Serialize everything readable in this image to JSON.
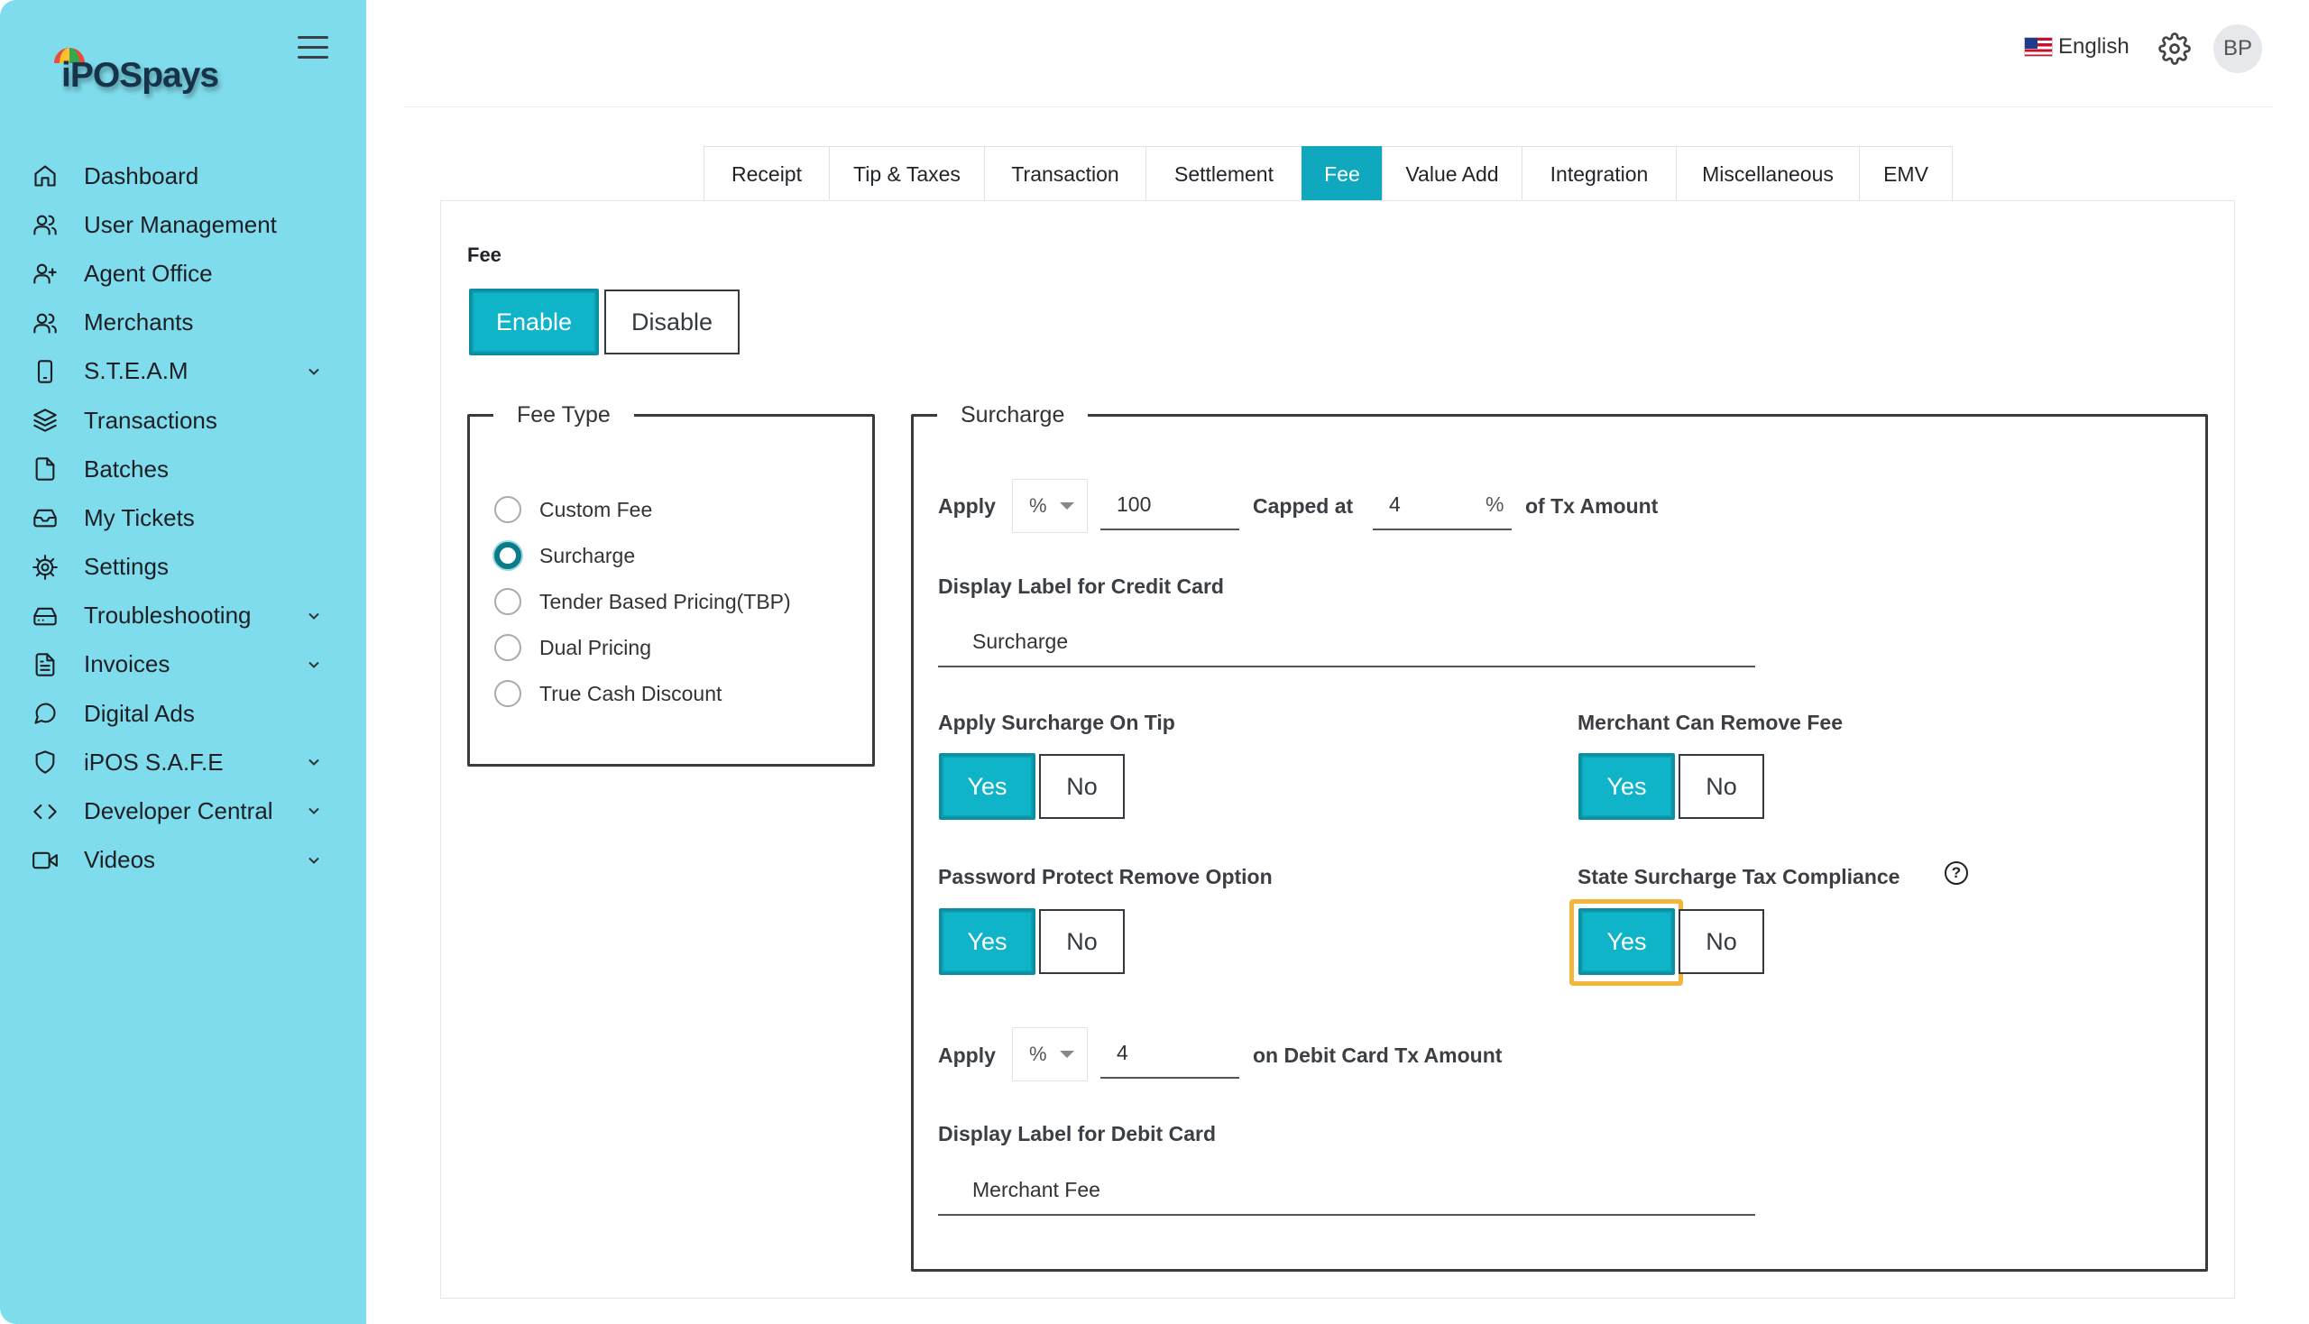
{
  "brand": {
    "logo_text": "iPOSpays"
  },
  "sidebar": {
    "items": [
      {
        "label": "Dashboard",
        "icon": "home-icon",
        "has_chevron": false
      },
      {
        "label": "User Management",
        "icon": "users-icon",
        "has_chevron": false
      },
      {
        "label": "Agent Office",
        "icon": "user-plus-icon",
        "has_chevron": false
      },
      {
        "label": "Merchants",
        "icon": "users-icon",
        "has_chevron": false
      },
      {
        "label": "S.T.E.A.M",
        "icon": "tablet-icon",
        "has_chevron": true
      },
      {
        "label": "Transactions",
        "icon": "layers-icon",
        "has_chevron": false
      },
      {
        "label": "Batches",
        "icon": "file-icon",
        "has_chevron": false
      },
      {
        "label": "My Tickets",
        "icon": "inbox-icon",
        "has_chevron": false
      },
      {
        "label": "Settings",
        "icon": "gear-icon",
        "has_chevron": false
      },
      {
        "label": "Troubleshooting",
        "icon": "hard-drive-icon",
        "has_chevron": true
      },
      {
        "label": "Invoices",
        "icon": "file-text-icon",
        "has_chevron": true
      },
      {
        "label": "Digital Ads",
        "icon": "message-circle-icon",
        "has_chevron": false
      },
      {
        "label": "iPOS S.A.F.E",
        "icon": "shield-icon",
        "has_chevron": true
      },
      {
        "label": "Developer Central",
        "icon": "code-icon",
        "has_chevron": true
      },
      {
        "label": "Videos",
        "icon": "video-icon",
        "has_chevron": true
      }
    ]
  },
  "header": {
    "language": "English",
    "avatar_initials": "BP"
  },
  "tabs": [
    {
      "label": "Receipt",
      "active": false
    },
    {
      "label": "Tip & Taxes",
      "active": false
    },
    {
      "label": "Transaction",
      "active": false
    },
    {
      "label": "Settlement",
      "active": false
    },
    {
      "label": "Fee",
      "active": true
    },
    {
      "label": "Value Add",
      "active": false
    },
    {
      "label": "Integration",
      "active": false
    },
    {
      "label": "Miscellaneous",
      "active": false
    },
    {
      "label": "EMV",
      "active": false
    }
  ],
  "fee": {
    "section_label": "Fee",
    "enable_label": "Enable",
    "disable_label": "Disable",
    "selected": "Enable"
  },
  "fee_type": {
    "legend": "Fee Type",
    "options": [
      "Custom Fee",
      "Surcharge",
      "Tender Based Pricing(TBP)",
      "Dual Pricing",
      "True Cash Discount"
    ],
    "selected": "Surcharge"
  },
  "surcharge": {
    "legend": "Surcharge",
    "apply_label": "Apply",
    "apply_unit": "%",
    "apply_value": "100",
    "capped_label": "Capped at",
    "capped_value": "4",
    "capped_suffix": "%",
    "tx_amount_label": "of Tx Amount",
    "credit_label_title": "Display Label for Credit Card",
    "credit_label_value": "Surcharge",
    "on_tip": {
      "label": "Apply Surcharge On Tip",
      "yes": "Yes",
      "no": "No",
      "selected": "Yes"
    },
    "merchant_remove": {
      "label": "Merchant Can Remove Fee",
      "yes": "Yes",
      "no": "No",
      "selected": "Yes"
    },
    "password_protect": {
      "label": "Password Protect Remove Option",
      "yes": "Yes",
      "no": "No",
      "selected": "Yes"
    },
    "state_compliance": {
      "label": "State Surcharge Tax Compliance",
      "help": "?",
      "yes": "Yes",
      "no": "No",
      "selected": "Yes"
    },
    "debit_apply_label": "Apply",
    "debit_unit": "%",
    "debit_value": "4",
    "debit_amount_label": "on Debit Card Tx Amount",
    "debit_label_title": "Display Label for Debit Card",
    "debit_label_value": "Merchant Fee"
  },
  "colors": {
    "sidebar_bg": "#7fdcec",
    "accent": "#10b4c8",
    "highlight": "#f2b73a"
  }
}
